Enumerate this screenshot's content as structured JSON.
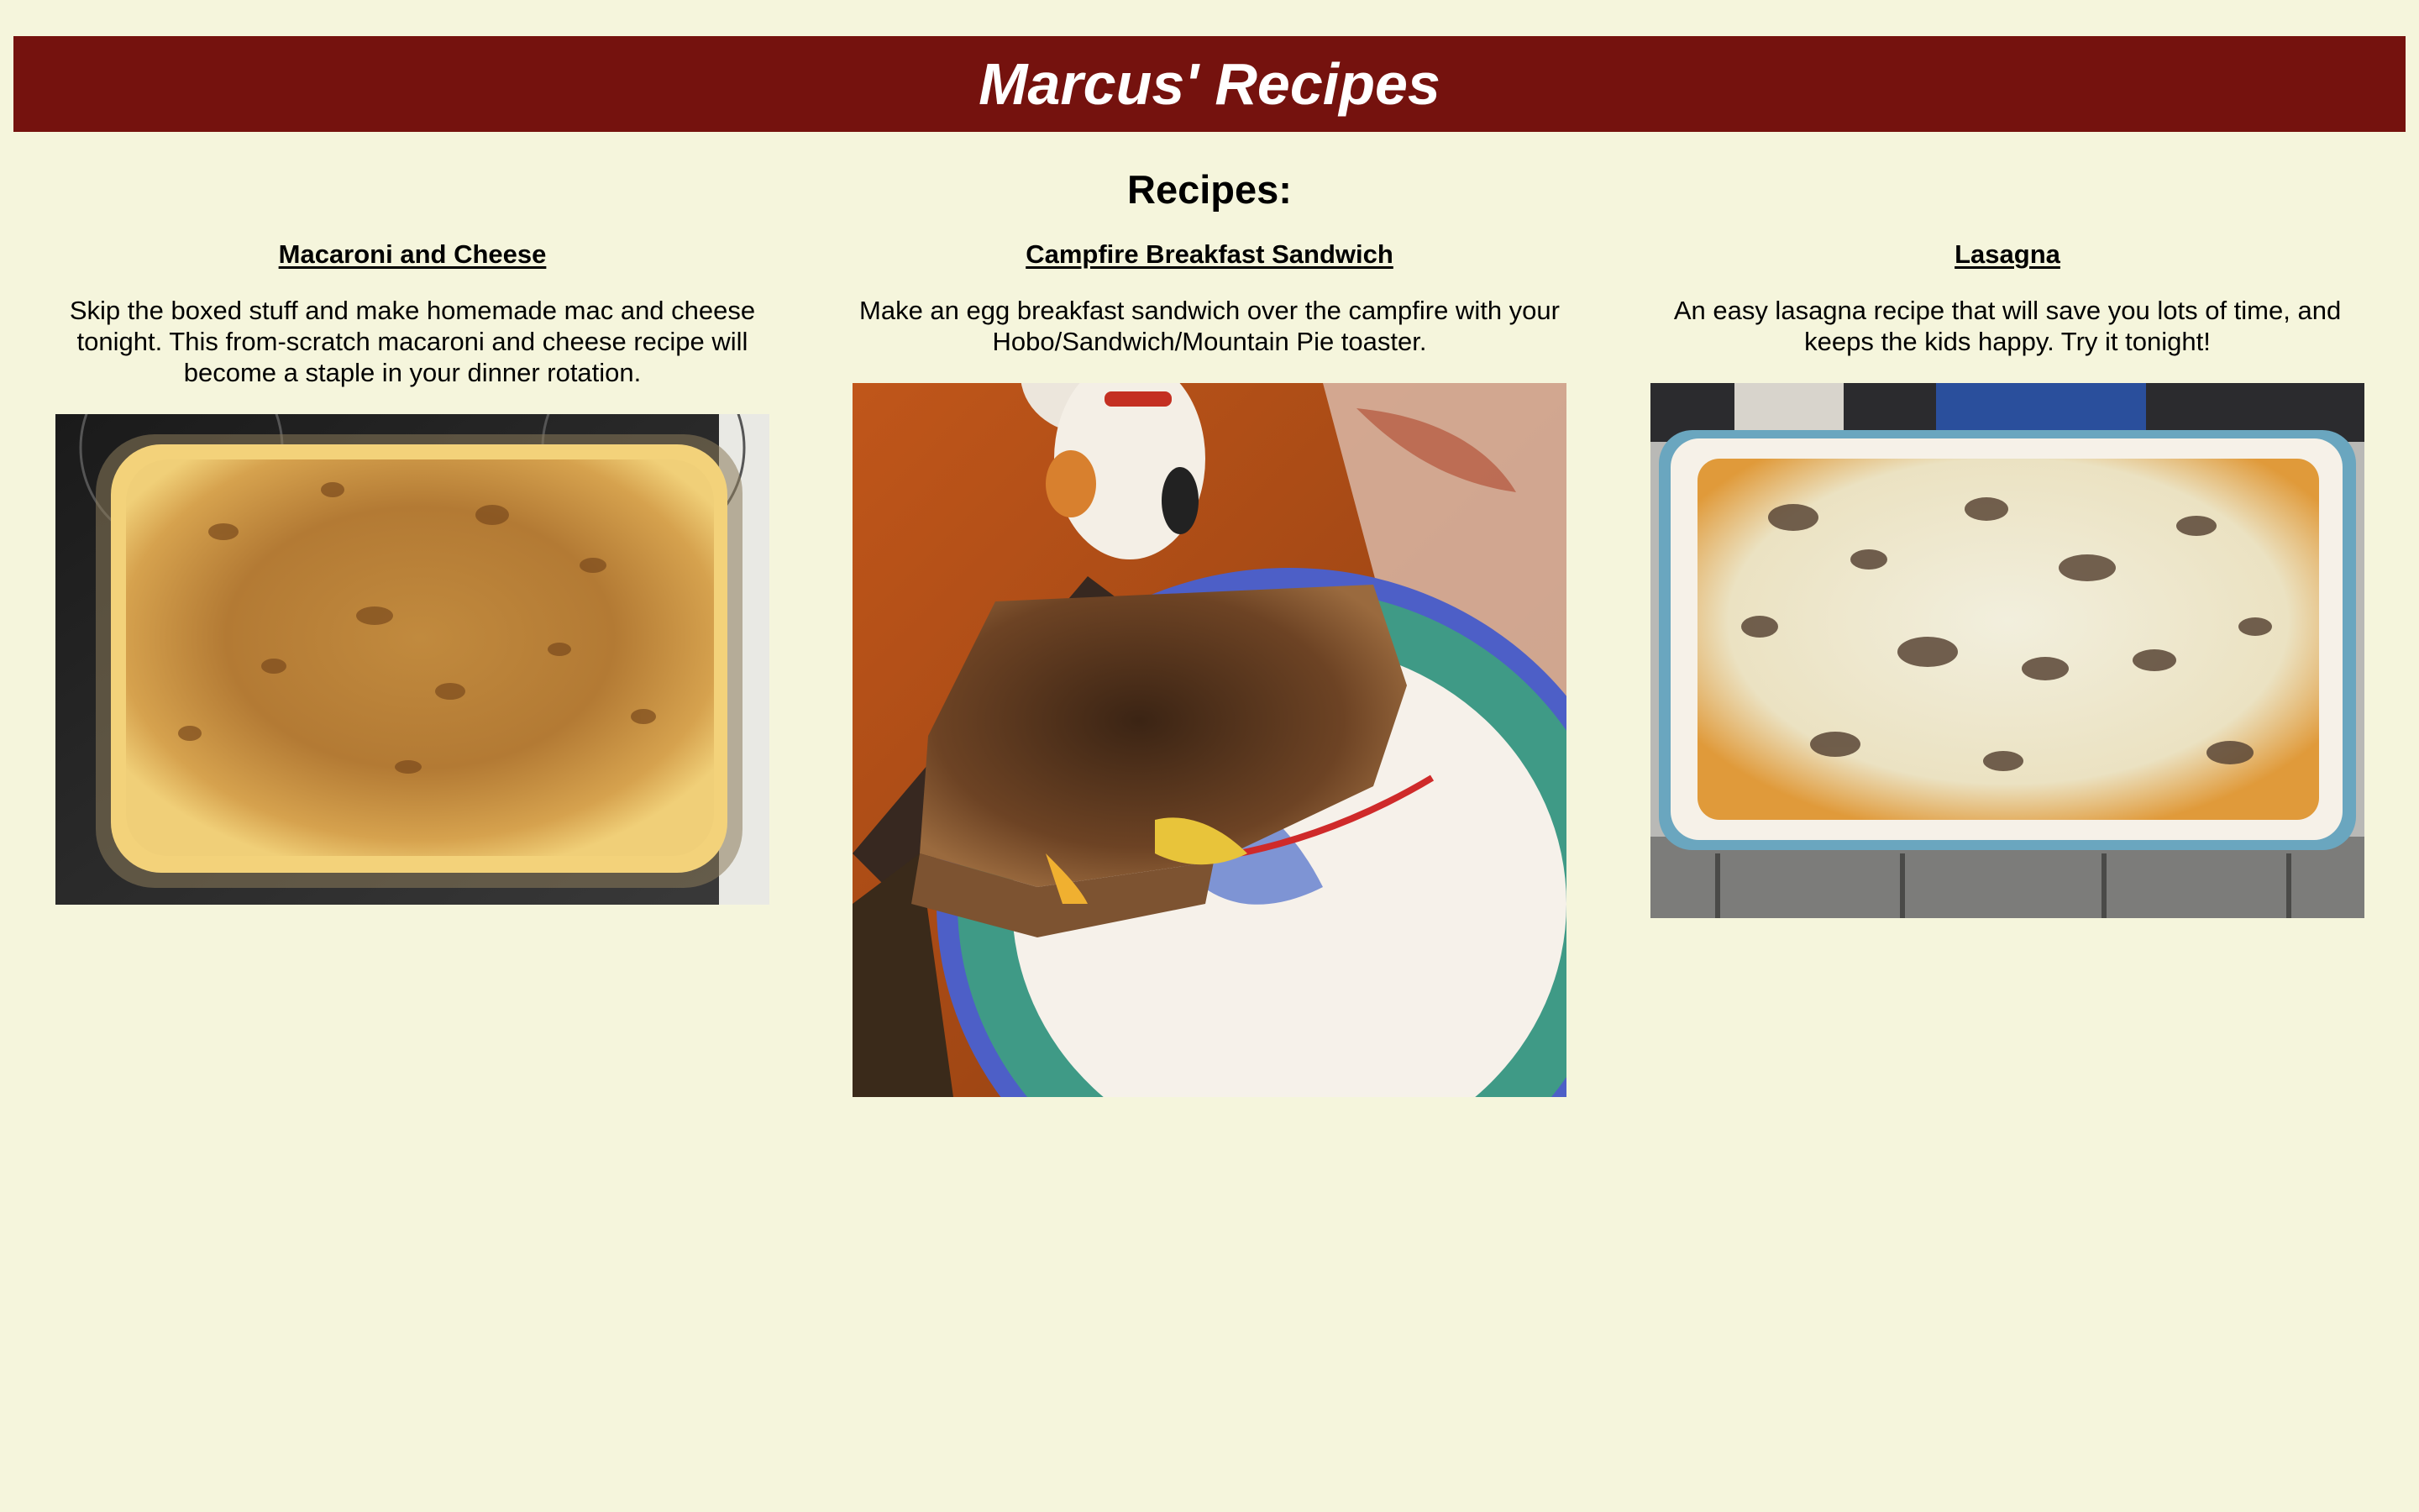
{
  "header": {
    "title": "Marcus' Recipes"
  },
  "main": {
    "heading": "Recipes:",
    "recipes": [
      {
        "title": "Macaroni and Cheese",
        "description": "Skip the boxed stuff and make homemade mac and cheese tonight. This from-scratch macaroni and cheese recipe will become a staple in your dinner rotation.",
        "image": "mac-and-cheese-photo"
      },
      {
        "title": "Campfire Breakfast Sandwich",
        "description": "Make an egg breakfast sandwich over the campfire with your Hobo/Sandwich/Mountain Pie toaster.",
        "image": "breakfast-sandwich-photo"
      },
      {
        "title": "Lasagna",
        "description": "An easy lasagna recipe that will save you lots of time, and keeps the kids happy. Try it tonight!",
        "image": "lasagna-photo"
      }
    ]
  },
  "colors": {
    "page_background": "#f5f5dc",
    "banner_background": "#75120e",
    "banner_text": "#ffffff"
  }
}
